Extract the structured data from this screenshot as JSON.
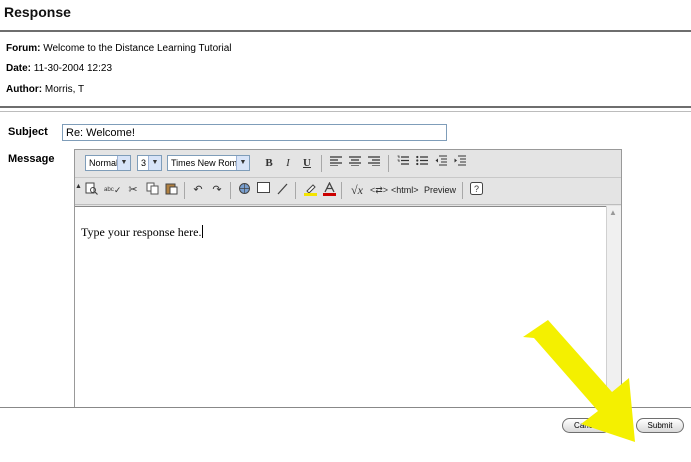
{
  "page": {
    "title": "Response"
  },
  "meta": {
    "forum_label": "Forum:",
    "forum_value": "Welcome to the Distance Learning Tutorial",
    "date_label": "Date:",
    "date_value": "11-30-2004 12:23",
    "author_label": "Author:",
    "author_value": "Morris, T"
  },
  "form": {
    "subject_label": "Subject",
    "subject_value": "Re: Welcome!",
    "message_label": "Message"
  },
  "editor": {
    "style_select": "Normal",
    "size_select": "3",
    "font_select": "Times New Roman",
    "bold": "B",
    "italic": "I",
    "underline": "U",
    "html_label": "<html>",
    "preview_label": "Preview",
    "body_text": "Type your response here."
  },
  "buttons": {
    "cancel": "Cancel",
    "submit": "Submit"
  },
  "colors": {
    "highlight_arrow": "#f4f000",
    "rule": "#6e6e6e",
    "accent_a": "#cc0000"
  }
}
